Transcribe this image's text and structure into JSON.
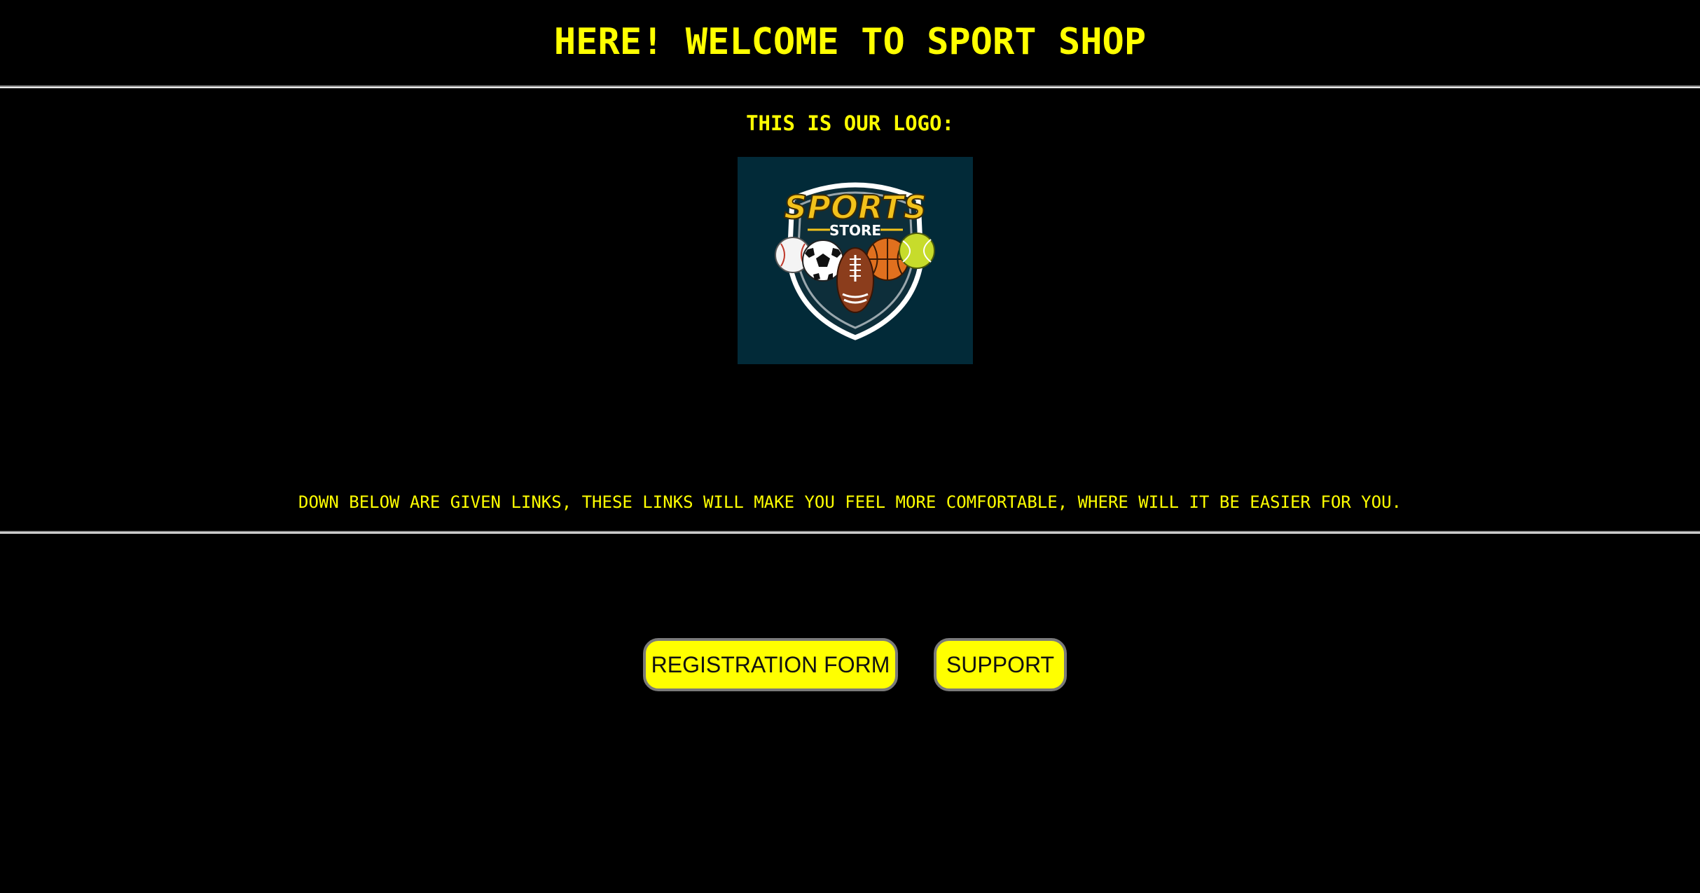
{
  "header": {
    "title": "HERE! WELCOME TO SPORT SHOP"
  },
  "logo_section": {
    "heading": "THIS IS OUR LOGO:",
    "logo": {
      "line1": "SPORTS",
      "line2": "STORE",
      "background_color": "#022a38",
      "text_color": "#f2c21b",
      "icons": [
        "baseball-icon",
        "soccer-ball-icon",
        "american-football-icon",
        "basketball-icon",
        "tennis-ball-icon",
        "shield-icon"
      ]
    }
  },
  "links_intro": "DOWN BELOW ARE GIVEN LINKS, THESE LINKS WILL MAKE YOU FEEL MORE COMFORTABLE, WHERE WILL IT BE EASIER FOR YOU.",
  "buttons": {
    "registration": "REGISTRATION FORM",
    "support": "SUPPORT"
  },
  "colors": {
    "background": "#000000",
    "accent": "#ffff00",
    "button_text": "#111111"
  }
}
